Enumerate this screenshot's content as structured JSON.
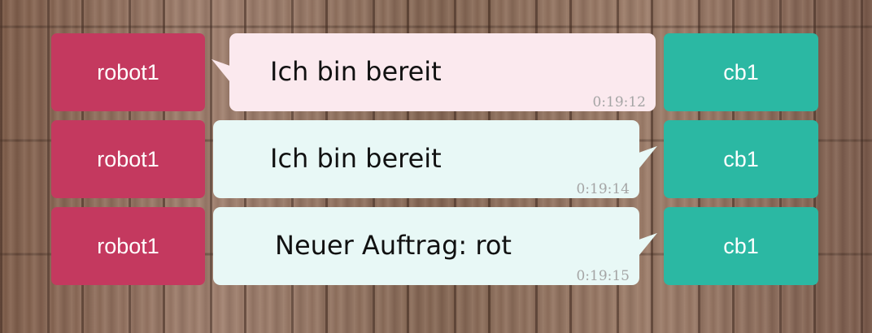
{
  "messages": [
    {
      "left_agent": "robot1",
      "right_agent": "cb1",
      "text": "Ich bin bereit",
      "time": "0:19:12",
      "sender": "robot1"
    },
    {
      "left_agent": "robot1",
      "right_agent": "cb1",
      "text": "Ich bin bereit",
      "time": "0:19:14",
      "sender": "cb1"
    },
    {
      "left_agent": "robot1",
      "right_agent": "cb1",
      "text": "Neuer Auftrag: rot",
      "time": "0:19:15",
      "sender": "cb1"
    }
  ],
  "colors": {
    "robot_accent": "#c4395f",
    "cb_accent": "#2bb8a3",
    "robot_bubble": "#fbe9ee",
    "cb_bubble": "#e8f8f6",
    "timestamp": "#a5a5a5"
  }
}
